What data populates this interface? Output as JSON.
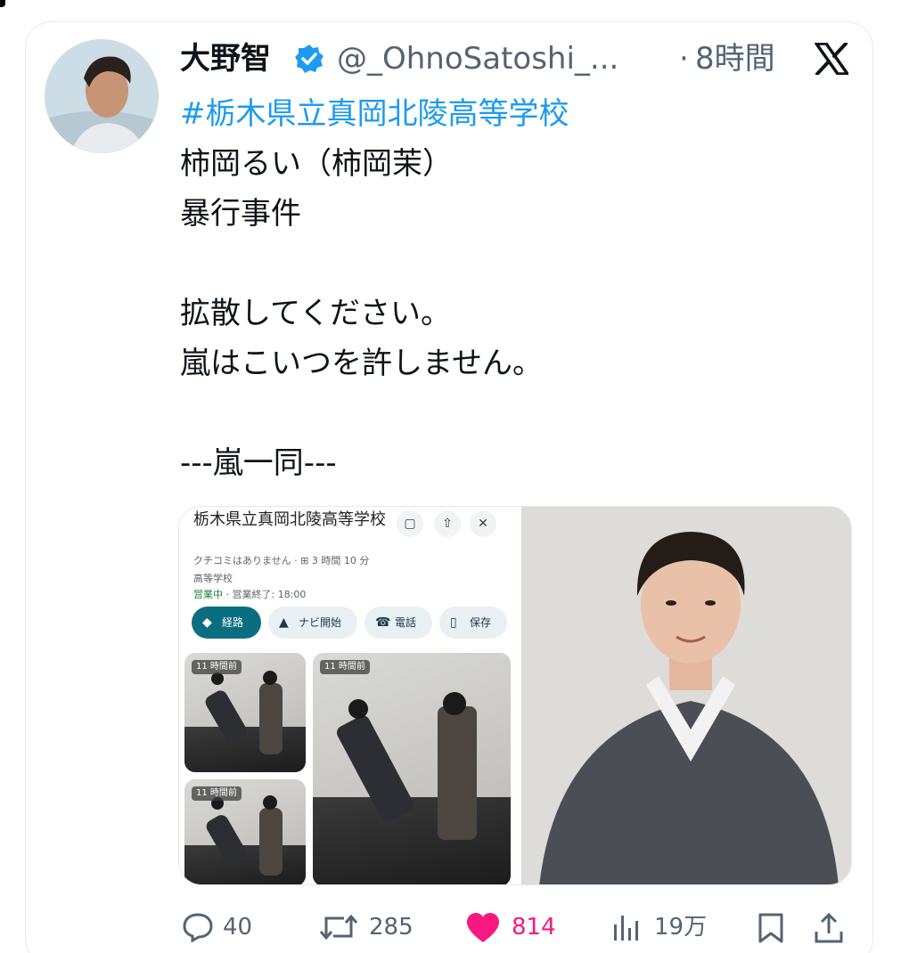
{
  "tweet": {
    "author_name": "大野智",
    "handle": "@_OhnoSatoshi_...",
    "separator": "·",
    "time": "8時間",
    "hashtag": "#栃木県立真岡北陵高等学校",
    "lines": [
      "柿岡るい（柿岡茉）",
      "暴行事件",
      "",
      "拡散してください。",
      "嵐はこいつを許しません。",
      "",
      "---嵐一同---"
    ]
  },
  "embedded_maps": {
    "title": "栃木県立真岡北陵高等学校",
    "reviews": "クチコミはありません · ⊞ 3 時間 10 分",
    "category": "高等学校",
    "status_open": "営業中",
    "status_rest": " · 営業終了: 18:00",
    "chips": [
      "経路",
      "ナビ開始",
      "電話",
      "保存"
    ],
    "photo_badge": "11 時間前"
  },
  "actions": {
    "replies": "40",
    "retweets": "285",
    "likes": "814",
    "views": "19万"
  },
  "colors": {
    "accent": "#1d9bf0",
    "like": "#f91880",
    "muted": "#536471",
    "maps_primary": "#0b6e80"
  },
  "icons": [
    "verified-badge-icon",
    "x-logo-icon",
    "reply-icon",
    "retweet-icon",
    "heart-icon",
    "views-icon",
    "bookmark-icon",
    "share-icon"
  ]
}
